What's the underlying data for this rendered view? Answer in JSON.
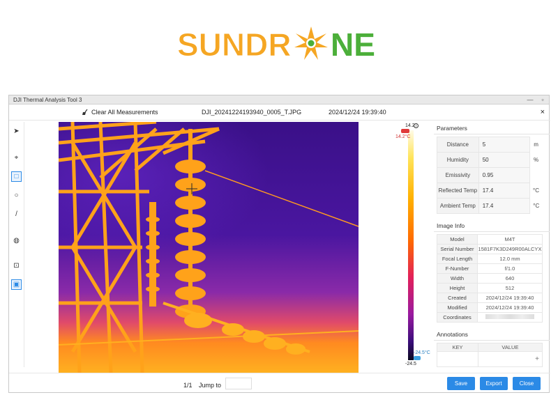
{
  "logo": {
    "part1": "SUNDR",
    "part2": "NE",
    "color_orange": "#f5a623",
    "color_green": "#4caf3a"
  },
  "window": {
    "title": "DJI Thermal Analysis Tool 3",
    "controls": {
      "minimize": "—",
      "maximize": "▫"
    }
  },
  "topbar": {
    "clear_all": "Clear All Measurements",
    "file_name": "DJI_20241224193940_0005_T.JPG",
    "file_date": "2024/12/24 19:39:40",
    "close": "×"
  },
  "tools": [
    {
      "name": "select-tool",
      "icon": "cursor-icon",
      "glyph": "➤"
    },
    {
      "name": "point-tool",
      "icon": "crosshair-icon",
      "glyph": "⌖"
    },
    {
      "name": "rectangle-tool",
      "icon": "square-icon",
      "glyph": "□"
    },
    {
      "name": "circle-tool",
      "icon": "circle-icon",
      "glyph": "○"
    },
    {
      "name": "line-tool",
      "icon": "line-icon",
      "glyph": "/"
    },
    {
      "name": "palette-tool",
      "icon": "palette-icon",
      "glyph": "◍"
    },
    {
      "name": "isotherm-tool",
      "icon": "isotherm-icon",
      "glyph": "⊡"
    },
    {
      "name": "display-tool",
      "icon": "display-icon",
      "glyph": "▣"
    }
  ],
  "scale": {
    "max_value": "14.2",
    "max_temp": "14.2°C",
    "min_temp": "-24.5°C",
    "min_value": "-24.5"
  },
  "parameters": {
    "title": "Parameters",
    "rows": [
      {
        "label": "Distance",
        "value": "5",
        "unit": "m"
      },
      {
        "label": "Humidity",
        "value": "50",
        "unit": "%"
      },
      {
        "label": "Emissivity",
        "value": "0.95",
        "unit": ""
      },
      {
        "label": "Reflected Temp",
        "value": "17.4",
        "unit": "°C"
      },
      {
        "label": "Ambient Temp",
        "value": "17.4",
        "unit": "°C"
      }
    ]
  },
  "image_info": {
    "title": "Image Info",
    "rows": [
      {
        "label": "Model",
        "value": "M4T"
      },
      {
        "label": "Serial Number",
        "value": "1581F7K3D249R00ALCYX"
      },
      {
        "label": "Focal Length",
        "value": "12.0 mm"
      },
      {
        "label": "F-Number",
        "value": "f/1.0"
      },
      {
        "label": "Width",
        "value": "640"
      },
      {
        "label": "Height",
        "value": "512"
      },
      {
        "label": "Created",
        "value": "2024/12/24 19:39:40"
      },
      {
        "label": "Modified",
        "value": "2024/12/24 19:39:40"
      },
      {
        "label": "Coordinates",
        "value": ""
      }
    ]
  },
  "annotations": {
    "title": "Annotations",
    "key_header": "KEY",
    "value_header": "VALUE",
    "add": "+"
  },
  "bottombar": {
    "page": "1/1",
    "jump_to": "Jump to",
    "save": "Save",
    "export": "Export",
    "close": "Close"
  }
}
